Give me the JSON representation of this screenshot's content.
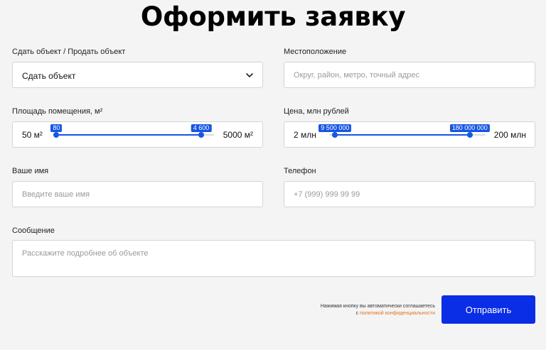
{
  "title": "Оформить заявку",
  "deal": {
    "label": "Сдать объект / Продать объект",
    "value": "Сдать объект",
    "icon": "chevron-down-icon"
  },
  "location": {
    "label": "Местоположение",
    "placeholder": "Округ, район, метро, точный адрес"
  },
  "area": {
    "label": "Площадь помещения, м²",
    "min_label": "50 м²",
    "max_label": "5000 м²",
    "min": 50,
    "max": 5000,
    "value_from": 80,
    "value_to": 4600,
    "from_label": "80",
    "to_label": "4 600"
  },
  "price": {
    "label": "Цена, млн рублей",
    "min_label": "2 млн",
    "max_label": "200 млн",
    "min": 2000000,
    "max": 200000000,
    "value_from": 9500000,
    "value_to": 180000000,
    "from_label": "9 500 000",
    "to_label": "180 000 000"
  },
  "name": {
    "label": "Ваше имя",
    "placeholder": "Введите ваше имя"
  },
  "phone": {
    "label": "Телефон",
    "placeholder": "+7 (999) 999 99 99"
  },
  "message": {
    "label": "Сообщение",
    "placeholder": "Расскажите подробнее об объекте"
  },
  "consent": {
    "line1": "Нажимая кнопку вы автоматически соглашаетесь",
    "prefix": "с",
    "link": "политикой конфиденциальности"
  },
  "submit_label": "Отправить",
  "colors": {
    "accent": "#1656e4",
    "button": "#0a2de6",
    "link": "#e2731c",
    "background": "#f4f4f4"
  }
}
